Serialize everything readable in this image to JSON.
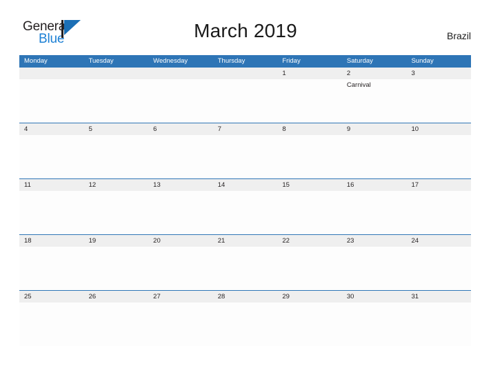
{
  "brand": {
    "name_part1": "General",
    "name_part2": "Blue",
    "mark": "triangle-logo-icon"
  },
  "header": {
    "title": "March 2019",
    "locale": "Brazil"
  },
  "colors": {
    "header_blue": "#2e75b6",
    "row_band_gray": "#efefef",
    "brand_blue": "#1b7fd4",
    "text_dark": "#231f20"
  },
  "calendar": {
    "month": "March",
    "year": "2019",
    "country": "Brazil",
    "weekdays": [
      "Monday",
      "Tuesday",
      "Wednesday",
      "Thursday",
      "Friday",
      "Saturday",
      "Sunday"
    ],
    "weeks": [
      {
        "days": [
          {
            "num": "",
            "events": []
          },
          {
            "num": "",
            "events": []
          },
          {
            "num": "",
            "events": []
          },
          {
            "num": "",
            "events": []
          },
          {
            "num": "1",
            "events": []
          },
          {
            "num": "2",
            "events": [
              "Carnival"
            ]
          },
          {
            "num": "3",
            "events": []
          }
        ]
      },
      {
        "days": [
          {
            "num": "4",
            "events": []
          },
          {
            "num": "5",
            "events": []
          },
          {
            "num": "6",
            "events": []
          },
          {
            "num": "7",
            "events": []
          },
          {
            "num": "8",
            "events": []
          },
          {
            "num": "9",
            "events": []
          },
          {
            "num": "10",
            "events": []
          }
        ]
      },
      {
        "days": [
          {
            "num": "11",
            "events": []
          },
          {
            "num": "12",
            "events": []
          },
          {
            "num": "13",
            "events": []
          },
          {
            "num": "14",
            "events": []
          },
          {
            "num": "15",
            "events": []
          },
          {
            "num": "16",
            "events": []
          },
          {
            "num": "17",
            "events": []
          }
        ]
      },
      {
        "days": [
          {
            "num": "18",
            "events": []
          },
          {
            "num": "19",
            "events": []
          },
          {
            "num": "20",
            "events": []
          },
          {
            "num": "21",
            "events": []
          },
          {
            "num": "22",
            "events": []
          },
          {
            "num": "23",
            "events": []
          },
          {
            "num": "24",
            "events": []
          }
        ]
      },
      {
        "days": [
          {
            "num": "25",
            "events": []
          },
          {
            "num": "26",
            "events": []
          },
          {
            "num": "27",
            "events": []
          },
          {
            "num": "28",
            "events": []
          },
          {
            "num": "29",
            "events": []
          },
          {
            "num": "30",
            "events": []
          },
          {
            "num": "31",
            "events": []
          }
        ]
      }
    ]
  }
}
